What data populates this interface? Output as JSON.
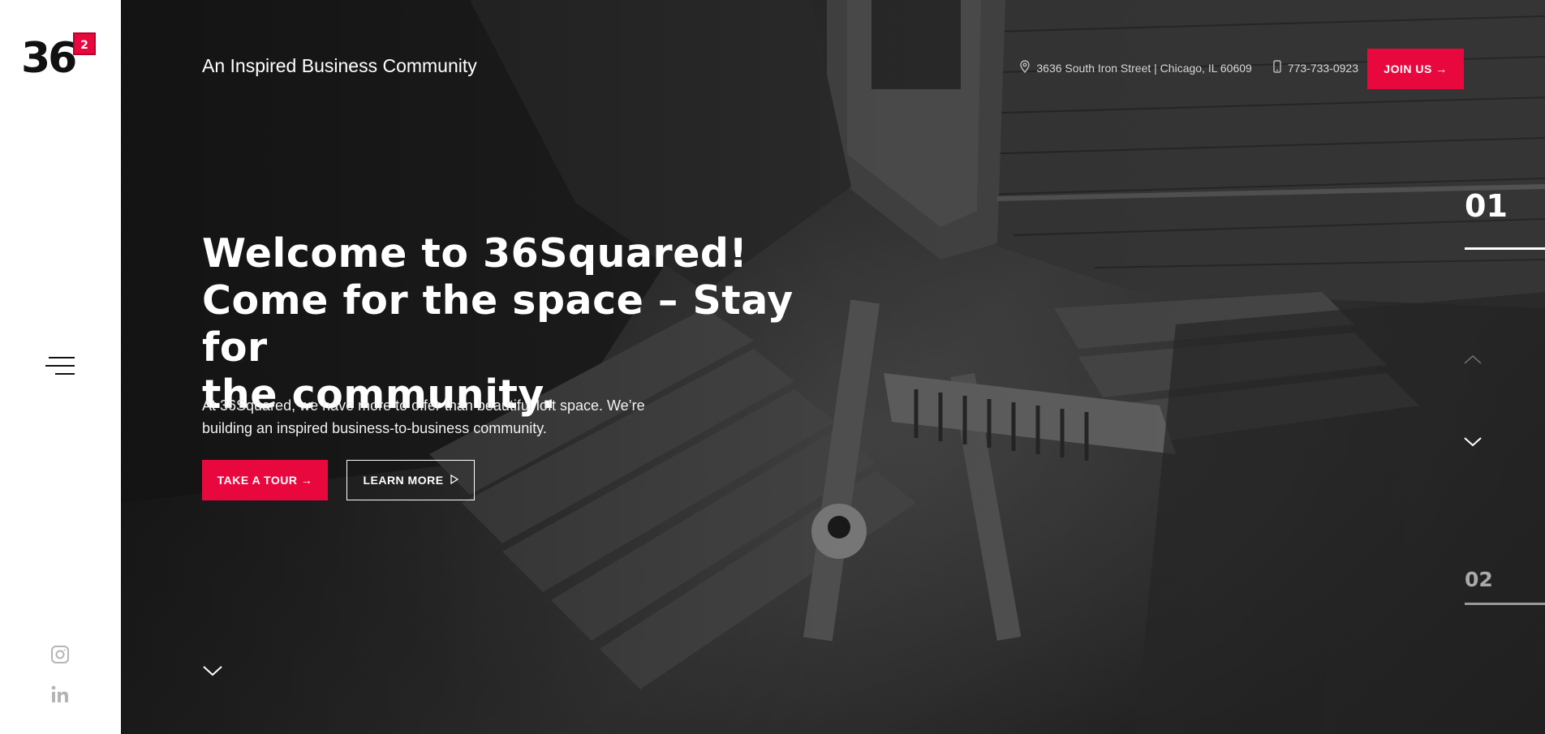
{
  "brand": {
    "logo_text": "36",
    "logo_badge": "2",
    "accent": "#e8083e"
  },
  "sidebar": {
    "menu_icon": "hamburger-menu-icon",
    "social": [
      {
        "name": "instagram-icon"
      },
      {
        "name": "linkedin-icon"
      }
    ]
  },
  "header": {
    "tagline": "An Inspired Business Community",
    "address": "3636 South Iron Street | Chicago, IL 60609",
    "phone": "773-733-0923",
    "join_label": "JOIN US →"
  },
  "hero": {
    "headline_line1": "Welcome to 36Squared!",
    "headline_line2": "Come for the space – Stay for",
    "headline_line3": "the community.",
    "subtext": "At 36Squared, we have more to offer than beautiful loft space. We’re building an inspired business-to-business community.",
    "tour_label": "TAKE A TOUR →",
    "learn_label": "LEARN MORE"
  },
  "slider": {
    "current": "01",
    "next": "02"
  }
}
